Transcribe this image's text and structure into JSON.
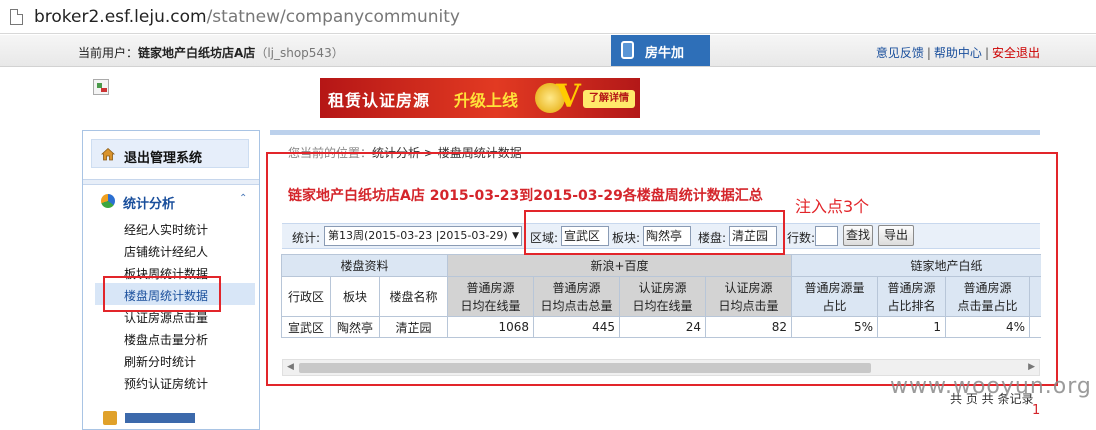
{
  "browser": {
    "url_host": "broker2.esf.leju.com",
    "url_path": "/statnew/companycommunity"
  },
  "header": {
    "current_user_label": "当前用户：",
    "current_user_name": "链家地产白纸坊店A店",
    "account": "（lj_shop543）",
    "niu_label": "房牛加",
    "links": {
      "feedback": "意见反馈",
      "sep": "|",
      "help": "帮助中心",
      "exit": "安全退出"
    }
  },
  "banner": {
    "text1": "租赁认证房源",
    "text2": "升级上线",
    "vmark": "V",
    "button": "了解详情"
  },
  "sidebar": {
    "exit_label": "退出管理系统",
    "section_title": "统计分析",
    "section_chevron": "⌃",
    "items": [
      "经纪人实时统计",
      "店铺统计经纪人",
      "板块周统计数据",
      "楼盘周统计数据",
      "认证房源点击量",
      "楼盘点击量分析",
      "刷新分时统计",
      "预约认证房统计"
    ],
    "active_index": 3
  },
  "main": {
    "breadcrumb_prefix": "您当前的位置：",
    "breadcrumb": "统计分析 > 楼盘周统计数据",
    "title": "链家地产白纸坊店A店 2015-03-23到2015-03-29各楼盘周统计数据汇总",
    "annotation": "注入点3个"
  },
  "filters": {
    "week_label": "统计:",
    "week_value": "第13周(2015-03-23 |2015-03-29)",
    "district_label": "区域:",
    "district_value": "宣武区",
    "plate_label": "板块:",
    "plate_value": "陶然亭",
    "estate_label": "楼盘:",
    "estate_value": "清芷园",
    "rows_label": "行数:",
    "rows_value": "",
    "search_button": "查找",
    "export_button": "导出"
  },
  "table": {
    "group_headers": [
      "楼盘资料",
      "新浪+百度",
      "链家地产白纸"
    ],
    "columns": [
      [
        "行政区"
      ],
      [
        "板块"
      ],
      [
        "楼盘名称"
      ],
      [
        "普通房源",
        "日均在线量"
      ],
      [
        "普通房源",
        "日均点击总量"
      ],
      [
        "认证房源",
        "日均在线量"
      ],
      [
        "认证房源",
        "日均点击量"
      ],
      [
        "普通房源量",
        "占比"
      ],
      [
        "普通房源",
        "占比排名"
      ],
      [
        "普通房源",
        "点击量占比"
      ]
    ],
    "rows": [
      [
        "宣武区",
        "陶然亭",
        "清芷园",
        "1068",
        "445",
        "24",
        "82",
        "5%",
        "1",
        "4%"
      ]
    ]
  },
  "footer": {
    "record_text": "共 页 共 条记录",
    "page_num": "1",
    "watermark": "www.wooyun.org"
  }
}
